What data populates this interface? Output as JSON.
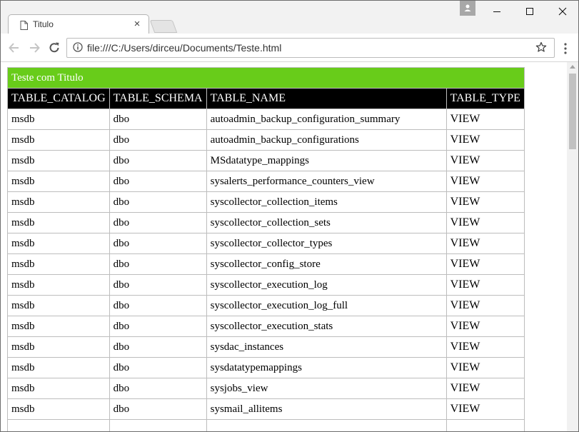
{
  "tab": {
    "title": "Titulo",
    "close": "×"
  },
  "address": {
    "url": "file:///C:/Users/dirceu/Documents/Teste.html"
  },
  "icons": {
    "doc": "document-icon",
    "close": "close-icon",
    "back": "arrow-left-icon",
    "forward": "arrow-right-icon",
    "reload": "reload-icon",
    "info": "info-icon",
    "star": "star-icon",
    "menu": "kebab-menu-icon",
    "profile": "profile-icon",
    "minimize": "minimize-icon",
    "maximize": "maximize-icon",
    "close_window": "close-window-icon"
  },
  "colors": {
    "title_bg": "#68cc1a",
    "header_bg": "#000000"
  },
  "table": {
    "title": "Teste com Titulo",
    "headers": [
      "TABLE_CATALOG",
      "TABLE_SCHEMA",
      "TABLE_NAME",
      "TABLE_TYPE"
    ],
    "rows": [
      [
        "msdb",
        "dbo",
        "autoadmin_backup_configuration_summary",
        "VIEW"
      ],
      [
        "msdb",
        "dbo",
        "autoadmin_backup_configurations",
        "VIEW"
      ],
      [
        "msdb",
        "dbo",
        "MSdatatype_mappings",
        "VIEW"
      ],
      [
        "msdb",
        "dbo",
        "sysalerts_performance_counters_view",
        "VIEW"
      ],
      [
        "msdb",
        "dbo",
        "syscollector_collection_items",
        "VIEW"
      ],
      [
        "msdb",
        "dbo",
        "syscollector_collection_sets",
        "VIEW"
      ],
      [
        "msdb",
        "dbo",
        "syscollector_collector_types",
        "VIEW"
      ],
      [
        "msdb",
        "dbo",
        "syscollector_config_store",
        "VIEW"
      ],
      [
        "msdb",
        "dbo",
        "syscollector_execution_log",
        "VIEW"
      ],
      [
        "msdb",
        "dbo",
        "syscollector_execution_log_full",
        "VIEW"
      ],
      [
        "msdb",
        "dbo",
        "syscollector_execution_stats",
        "VIEW"
      ],
      [
        "msdb",
        "dbo",
        "sysdac_instances",
        "VIEW"
      ],
      [
        "msdb",
        "dbo",
        "sysdatatypemappings",
        "VIEW"
      ],
      [
        "msdb",
        "dbo",
        "sysjobs_view",
        "VIEW"
      ],
      [
        "msdb",
        "dbo",
        "sysmail_allitems",
        "VIEW"
      ],
      [
        "",
        "",
        "",
        ""
      ]
    ]
  }
}
